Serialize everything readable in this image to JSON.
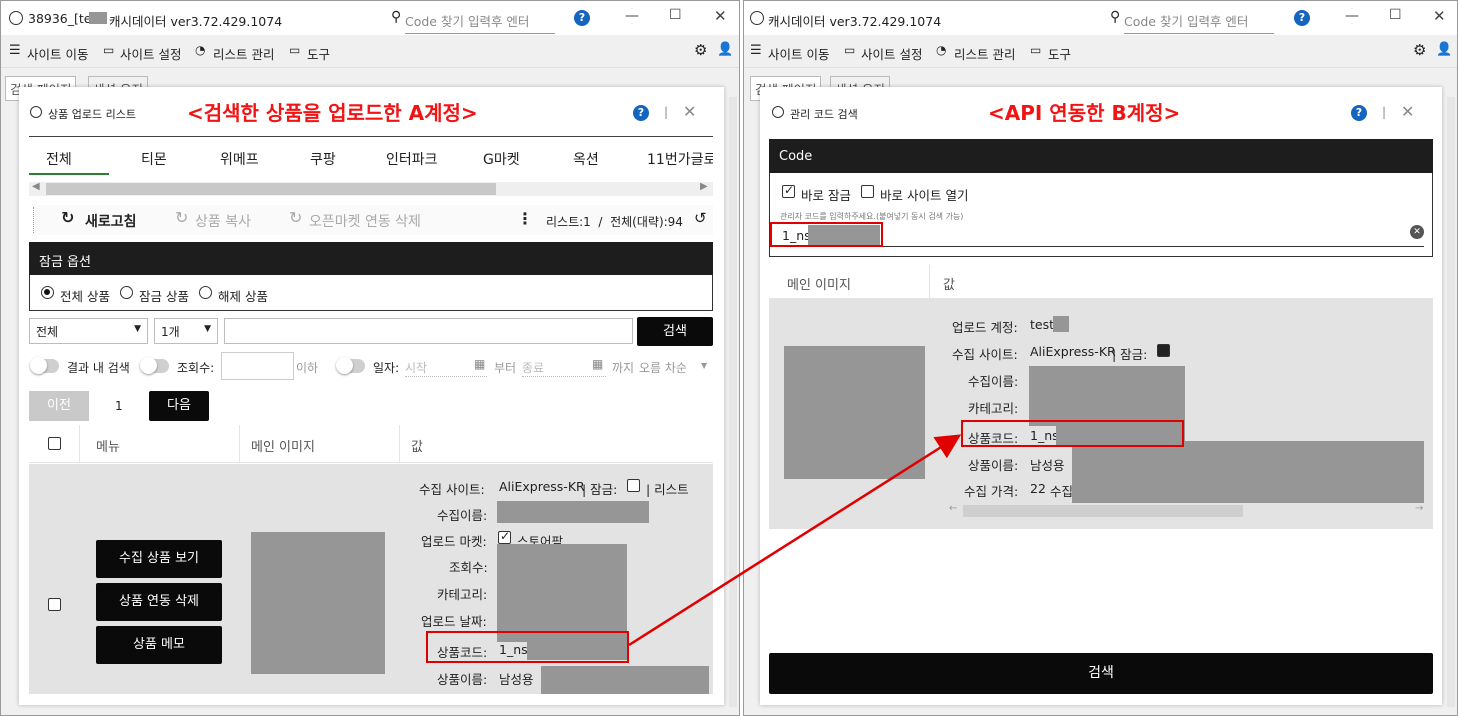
{
  "left_window": {
    "title_prefix": "38936_[test",
    "title_suffix": "캐시데이터 ver3.72.429.1074",
    "search_placeholder": "Code 찾기 입력후 엔터",
    "help": "?",
    "menu": [
      "사이트 이동",
      "사이트 설정",
      "리스트 관리",
      "도구"
    ],
    "page_tabs": [
      "검색 페이지",
      "세션 유지"
    ]
  },
  "right_window": {
    "title": "캐시데이터 ver3.72.429.1074",
    "search_placeholder": "Code 찾기 입력후 엔터",
    "help": "?",
    "menu": [
      "사이트 이동",
      "사이트 설정",
      "리스트 관리",
      "도구"
    ],
    "page_tabs": [
      "검색 페이지",
      "세션 유지"
    ]
  },
  "upload_dialog": {
    "title": "상품 업로드 리스트",
    "annotation": "<검색한 상품을 업로드한 A계정>",
    "help": "?",
    "market_tabs": [
      "전체",
      "티몬",
      "위메프",
      "쿠팡",
      "인터파크",
      "G마켓",
      "옥션",
      "11번가글로"
    ],
    "active_tab": "전체",
    "toolbar": {
      "refresh": "새로고침",
      "copy": "상품 복사",
      "unlink": "오픈마켓 연동 삭제",
      "count": "리스트:1  /  전체(대략):94"
    },
    "lock_options": {
      "header": "잠금 옵션",
      "radios": [
        "전체 상품",
        "잠금 상품",
        "해제 상품"
      ],
      "selected": "전체 상품"
    },
    "filter": {
      "select_all": "전체",
      "select_count": "1개",
      "search_button": "검색",
      "toggle_in_result": "결과 내 검색",
      "toggle_views": "조회수:",
      "views_suffix": "이하",
      "toggle_date": "일자:",
      "start_placeholder": "시작",
      "from_label": "부터",
      "end_placeholder": "종료",
      "until_label": "까지",
      "sort_label": "오름 차순"
    },
    "pager": {
      "prev": "이전",
      "page": "1",
      "next": "다음"
    },
    "table": {
      "headers": [
        "메뉴",
        "메인 이미지",
        "값"
      ],
      "row_buttons": [
        "수집 상품 보기",
        "상품 연동 삭제",
        "상품 메모"
      ],
      "fields": {
        "site_label": "수집 사이트:",
        "site_value": "AliExpress-KR",
        "lock_label": "| 잠금:",
        "list_label": "| 리스트",
        "collect_name_label": "수집이름:",
        "upload_market_label": "업로드 마켓:",
        "upload_market_value": "스토어팜",
        "views_label": "조회수:",
        "category_label": "카테고리:",
        "upload_date_label": "업로드 날짜:",
        "code_label": "상품코드:",
        "code_value": "1_ns",
        "product_name_label": "상품이름:",
        "product_name_value": "남성용"
      }
    }
  },
  "code_dialog": {
    "title": "관리 코드 검색",
    "annotation": "<API 연동한 B계정>",
    "help": "?",
    "code_header": "Code",
    "check_lock": "바로 잠금",
    "check_open": "바로 사이트 열기",
    "input_hint": "관리자 코드를 입력하주세요.(붙여넣기 동시 검색 가능)",
    "input_value": "1_ns",
    "table_headers": [
      "메인 이미지",
      "값"
    ],
    "fields": {
      "account_label": "업로드 계정:",
      "account_value": "test",
      "site_label": "수집 사이트:",
      "site_value": "AliExpress-KR",
      "lock_label": "| 잠금:",
      "collect_name_label": "수집이름:",
      "category_label": "카테고리:",
      "code_label": "상품코드:",
      "code_value": "1_ns",
      "product_name_label": "상품이름:",
      "product_name_value": "남성용",
      "price_label": "수집 가격:",
      "price_value": "22",
      "price_suffix": "수집"
    },
    "search_button": "검색"
  },
  "colors": {
    "annotation": "#f01414",
    "dark": "#0a0a0a",
    "help": "#1565c0",
    "redact": "#969696"
  }
}
